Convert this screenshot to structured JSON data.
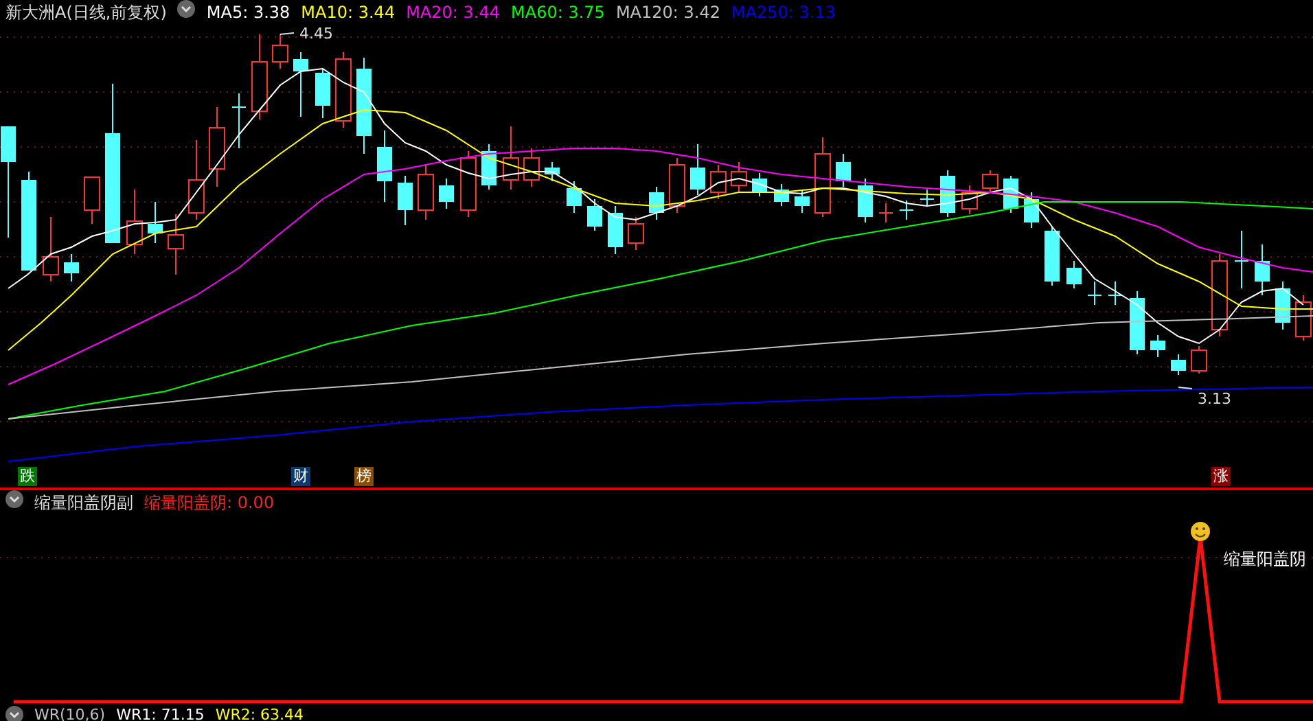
{
  "main_panel": {
    "title": "新大洲A(日线,前复权)",
    "ma_legend": [
      {
        "label": "MA5: 3.38",
        "color": "#ffffff"
      },
      {
        "label": "MA10: 3.44",
        "color": "#ffff00"
      },
      {
        "label": "MA20: 3.44",
        "color": "#ff00ff"
      },
      {
        "label": "MA60: 3.75",
        "color": "#00ff00"
      },
      {
        "label": "MA120: 3.42",
        "color": "#c0c0c0"
      },
      {
        "label": "MA250: 3.13",
        "color": "#0000ff"
      }
    ],
    "high_label": "4.45",
    "low_label": "3.13",
    "markers": [
      {
        "text": "跌",
        "color": "#007800"
      },
      {
        "text": "财",
        "color": "#0a3a6e"
      },
      {
        "text": "榜",
        "color": "#8c4c00"
      },
      {
        "text": "涨",
        "color": "#8c0000"
      }
    ]
  },
  "sub_panel": {
    "title": "缩量阳盖阴副",
    "value_label": "缩量阳盖阴: 0.00",
    "signal_label": "缩量阳盖阴"
  },
  "bottom_panel": {
    "legend": [
      {
        "label": "WR(10,6)",
        "color": "#c0c0c0"
      },
      {
        "label": "WR1: 71.15",
        "color": "#ffffff"
      },
      {
        "label": "WR2: 63.44",
        "color": "#ffff00"
      }
    ]
  }
}
